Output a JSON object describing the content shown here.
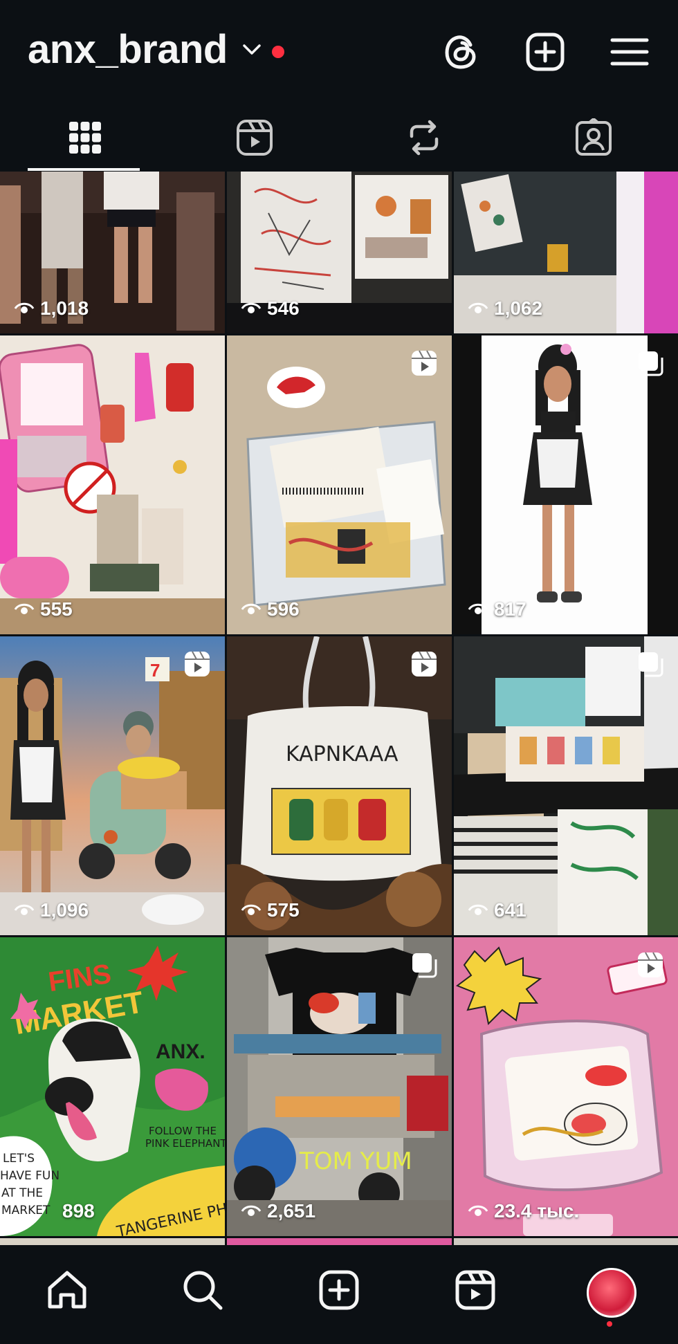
{
  "profile": {
    "username": "anx_brand"
  },
  "colors": {
    "background": "#0c1014",
    "notification": "#ff2f40",
    "text": "#f5f5f5"
  },
  "top_icons": [
    "threads-icon",
    "create-plus-icon",
    "menu-icon"
  ],
  "tabs": [
    {
      "icon": "grid-icon",
      "selected": true
    },
    {
      "icon": "reels-icon",
      "selected": false
    },
    {
      "icon": "reposts-icon",
      "selected": false
    },
    {
      "icon": "tagged-icon",
      "selected": false
    }
  ],
  "posts": [
    {
      "views": "1,018",
      "type": "image"
    },
    {
      "views": "546",
      "type": "image"
    },
    {
      "views": "1,062",
      "type": "image"
    },
    {
      "views": "555",
      "type": "image"
    },
    {
      "views": "596",
      "type": "reel"
    },
    {
      "views": "817",
      "type": "carousel"
    },
    {
      "views": "1,096",
      "type": "reel"
    },
    {
      "views": "575",
      "type": "reel"
    },
    {
      "views": "641",
      "type": "carousel"
    },
    {
      "views": "898",
      "type": "image"
    },
    {
      "views": "2,651",
      "type": "carousel"
    },
    {
      "views": "23.4 тыс.",
      "type": "reel"
    }
  ],
  "bottom_nav": [
    "home-icon",
    "search-icon",
    "create-icon",
    "reels-icon",
    "profile-avatar"
  ]
}
